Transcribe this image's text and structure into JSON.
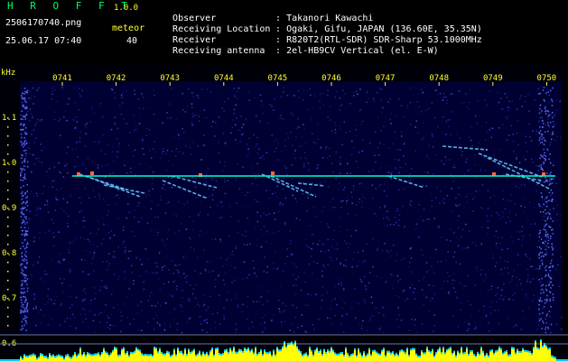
{
  "header": {
    "title": "H R O F F T",
    "version": "1.0.0",
    "file_name": "2506170740.png",
    "timestamp": "25.06.17 07:40",
    "meteor_label": "meteor",
    "meteor_count": "40"
  },
  "info": [
    {
      "key": "Observer",
      "value": ": Takanori Kawachi"
    },
    {
      "key": "Receiving Location",
      "value": ": Ogaki, Gifu, JAPAN (136.60E, 35.35N)"
    },
    {
      "key": "Receiver",
      "value": ": R820T2(RTL-SDR) SDR-Sharp 53.1000MHz"
    },
    {
      "key": "Receiving antenna",
      "value": ": 2el-HB9CV Vertical (el. E-W)"
    }
  ],
  "colors": {
    "background": "#000033",
    "header_green": "#00ff66",
    "label_yellow": "#ffff33",
    "carrier_line": "#00ffcc",
    "meteor_trail": "#66ccff",
    "histogram": "#ffff00",
    "histogram_bg": "#00ccff"
  },
  "chart_data": {
    "type": "heatmap",
    "ylabel": "kHz",
    "y_ticks": [
      "1.1",
      "1.0",
      "0.9",
      "0.8",
      "0.7",
      "0.6"
    ],
    "x_ticks": [
      "0741",
      "0742",
      "0743",
      "0744",
      "0745",
      "0746",
      "0747",
      "0748",
      "0749",
      "0750"
    ],
    "ylim": [
      0.6,
      1.15
    ],
    "carrier_frequency_khz": 0.97
  }
}
